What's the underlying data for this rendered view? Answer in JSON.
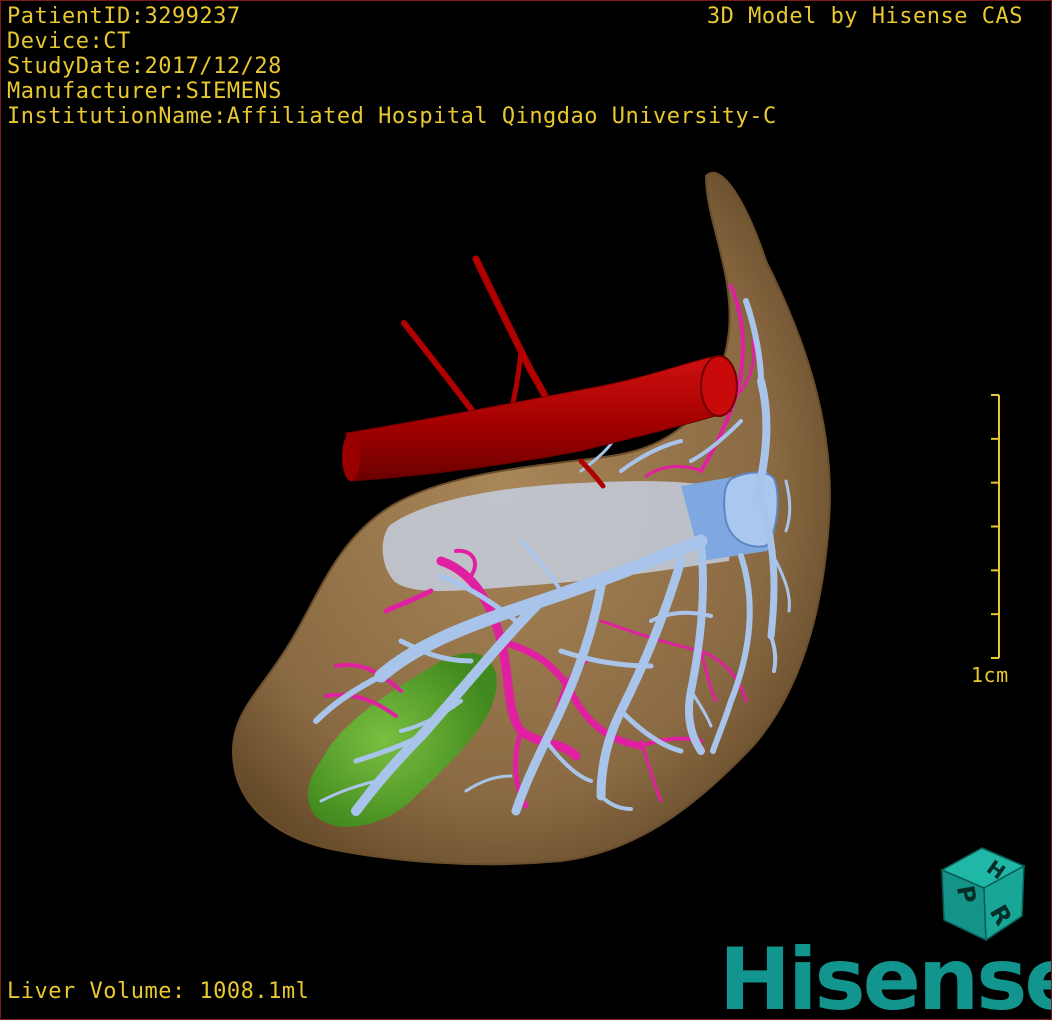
{
  "info": {
    "patient_id": "PatientID:3299237",
    "device": "Device:CT",
    "study_date": "StudyDate:2017/12/28",
    "manufacturer": "Manufacturer:SIEMENS",
    "institution": "InstitutionName:Affiliated Hospital Qingdao University-C"
  },
  "brand_caption": "3D Model by Hisense CAS",
  "liver_volume": "Liver Volume: 1008.1ml",
  "scale": {
    "label": "1cm",
    "ticks": 7
  },
  "orientation_cube": {
    "face_top": "H",
    "face_left": "P",
    "face_front": "R"
  },
  "logo": {
    "text": "Hisense"
  },
  "colors": {
    "text": "#e8c830",
    "liver": "#8a6a43",
    "artery": "#b00000",
    "portal_vein": "#a9c4ea",
    "hepatic_artery_branch": "#e020a0",
    "tumor": "#4fa626",
    "logo": "#12958e"
  }
}
